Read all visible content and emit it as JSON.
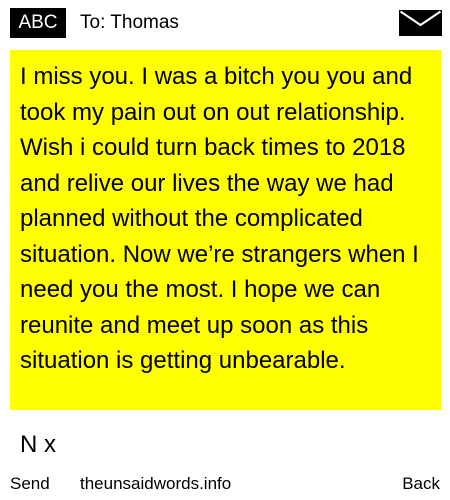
{
  "header": {
    "mode_label": "ABC",
    "recipient": "To: Thomas",
    "envelope_icon": "envelope-icon"
  },
  "message": {
    "body": "I miss you. I was a bitch you you and took my pain out on out relationship. Wish i could turn back times to 2018 and relive our lives the way we had planned without the complicated situation. Now we’re strangers when I need you the most. I hope we can reunite and meet up soon as this situation is getting unbearable.",
    "signature": "N x",
    "background_color": "#ffff00"
  },
  "footer": {
    "send_label": "Send",
    "site_label": "theunsaidwords.info",
    "back_label": "Back"
  }
}
